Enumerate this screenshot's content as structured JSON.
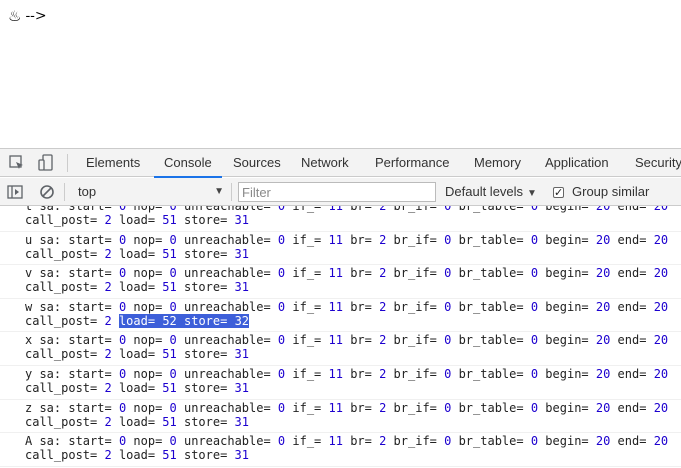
{
  "page": {
    "text": "-->",
    "icon": "coffee-cup-icon"
  },
  "devtools": {
    "tabs": [
      "Elements",
      "Console",
      "Sources",
      "Network",
      "Performance",
      "Memory",
      "Application",
      "Security"
    ],
    "active_tab": "Console",
    "toolbar": {
      "context": "top",
      "filter_placeholder": "Filter",
      "levels": "Default levels",
      "group_similar": "Group similar",
      "group_similar_checked": true
    },
    "accent": "#1a73e8",
    "highlight_color": "#3d5fd9"
  },
  "console": {
    "entries": [
      {
        "name": "t",
        "start": "0",
        "nop": "0",
        "unreachable": "0",
        "if": "11",
        "br": "2",
        "br_if": "0",
        "br_table": "0",
        "begin": "20",
        "end": "20",
        "call_post": "2",
        "load": "51",
        "store": "31"
      },
      {
        "name": "u",
        "start": "0",
        "nop": "0",
        "unreachable": "0",
        "if": "11",
        "br": "2",
        "br_if": "0",
        "br_table": "0",
        "begin": "20",
        "end": "20",
        "call_post": "2",
        "load": "51",
        "store": "31"
      },
      {
        "name": "v",
        "start": "0",
        "nop": "0",
        "unreachable": "0",
        "if": "11",
        "br": "2",
        "br_if": "0",
        "br_table": "0",
        "begin": "20",
        "end": "20",
        "call_post": "2",
        "load": "51",
        "store": "31"
      },
      {
        "name": "w",
        "start": "0",
        "nop": "0",
        "unreachable": "0",
        "if": "11",
        "br": "2",
        "br_if": "0",
        "br_table": "0",
        "begin": "20",
        "end": "20",
        "call_post": "2",
        "load": "52",
        "store": "32",
        "highlight": true
      },
      {
        "name": "x",
        "start": "0",
        "nop": "0",
        "unreachable": "0",
        "if": "11",
        "br": "2",
        "br_if": "0",
        "br_table": "0",
        "begin": "20",
        "end": "20",
        "call_post": "2",
        "load": "51",
        "store": "31"
      },
      {
        "name": "y",
        "start": "0",
        "nop": "0",
        "unreachable": "0",
        "if": "11",
        "br": "2",
        "br_if": "0",
        "br_table": "0",
        "begin": "20",
        "end": "20",
        "call_post": "2",
        "load": "51",
        "store": "31"
      },
      {
        "name": "z",
        "start": "0",
        "nop": "0",
        "unreachable": "0",
        "if": "11",
        "br": "2",
        "br_if": "0",
        "br_table": "0",
        "begin": "20",
        "end": "20",
        "call_post": "2",
        "load": "51",
        "store": "31"
      },
      {
        "name": "A",
        "start": "0",
        "nop": "0",
        "unreachable": "0",
        "if": "11",
        "br": "2",
        "br_if": "0",
        "br_table": "0",
        "begin": "20",
        "end": "20",
        "call_post": "2",
        "load": "51",
        "store": "31"
      }
    ]
  }
}
